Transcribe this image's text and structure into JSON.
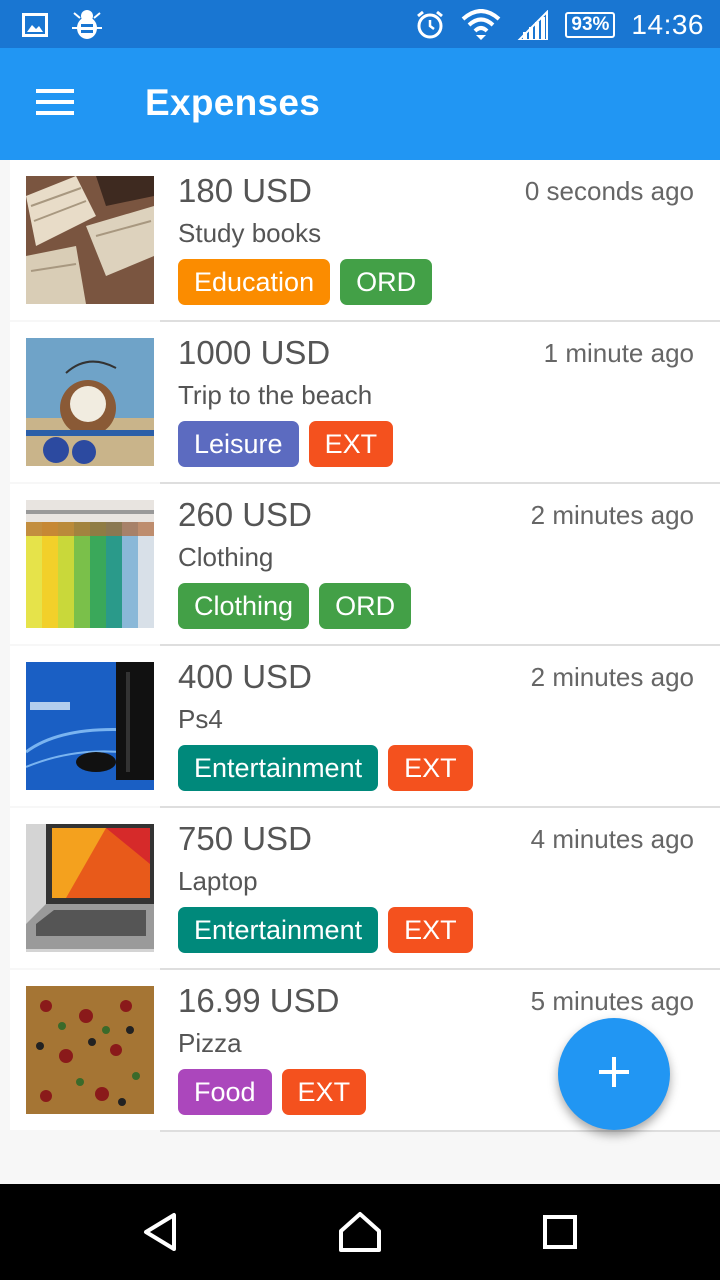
{
  "status_bar": {
    "left_icons": [
      "image-icon",
      "bug-icon"
    ],
    "right_icons": [
      "alarm-icon",
      "wifi-icon",
      "signal-icon"
    ],
    "battery": "93%",
    "time": "14:36"
  },
  "app_bar": {
    "title": "Expenses",
    "menu_icon": "hamburger-menu-icon"
  },
  "expenses": [
    {
      "amount": "180 USD",
      "time": "0 seconds ago",
      "description": "Study books",
      "image": "books-photo",
      "tags": [
        {
          "label": "Education",
          "color": "#fb8c00"
        },
        {
          "label": "ORD",
          "color": "#43a047"
        }
      ]
    },
    {
      "amount": "1000 USD",
      "time": "1 minute ago",
      "description": "Trip to the beach",
      "image": "beach-coconut-photo",
      "tags": [
        {
          "label": "Leisure",
          "color": "#5c6bc0"
        },
        {
          "label": "EXT",
          "color": "#f4511e"
        }
      ]
    },
    {
      "amount": "260 USD",
      "time": "2 minutes ago",
      "description": "Clothing",
      "image": "clothes-rack-photo",
      "tags": [
        {
          "label": "Clothing",
          "color": "#43a047"
        },
        {
          "label": "ORD",
          "color": "#43a047"
        }
      ]
    },
    {
      "amount": "400 USD",
      "time": "2 minutes ago",
      "description": "Ps4",
      "image": "ps4-console-photo",
      "tags": [
        {
          "label": "Entertainment",
          "color": "#00897b"
        },
        {
          "label": "EXT",
          "color": "#f4511e"
        }
      ]
    },
    {
      "amount": "750 USD",
      "time": "4 minutes ago",
      "description": "Laptop",
      "image": "laptop-photo",
      "tags": [
        {
          "label": "Entertainment",
          "color": "#00897b"
        },
        {
          "label": "EXT",
          "color": "#f4511e"
        }
      ]
    },
    {
      "amount": "16.99 USD",
      "time": "5 minutes ago",
      "description": "Pizza",
      "image": "pizza-photo",
      "tags": [
        {
          "label": "Food",
          "color": "#ab47bc"
        },
        {
          "label": "EXT",
          "color": "#f4511e"
        }
      ]
    }
  ],
  "fab": {
    "icon": "plus-icon"
  },
  "nav_bar": {
    "icons": [
      "back-icon",
      "home-icon",
      "recents-icon"
    ]
  },
  "colors": {
    "status_bar": "#1976d2",
    "app_bar": "#2196f3",
    "fab": "#2196f3"
  }
}
